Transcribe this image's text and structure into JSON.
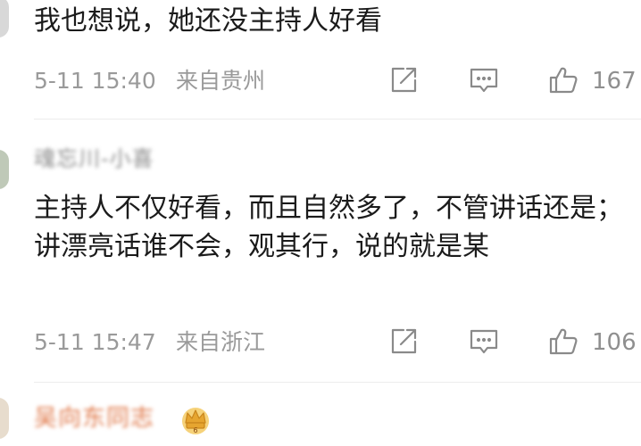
{
  "comments": [
    {
      "text": "我也想说，她还没主持人好看",
      "time": "5-11 15:40",
      "source": "来自贵州",
      "likes": "167"
    },
    {
      "username": "魂忘川-小喜",
      "text": "主持人不仅好看，而且自然多了，不管讲话还是； 讲漂亮话谁不会，观其行，说的就是某",
      "time": "5-11 15:47",
      "source": "来自浙江",
      "likes": "106"
    }
  ],
  "next_comment": {
    "username": "吴向东同志",
    "badge_icon": "crown-badge-icon"
  },
  "colors": {
    "text": "#1b1b1b",
    "meta": "#9a9a9a",
    "icon": "#8a8a8a",
    "vip_name": "#e0794a",
    "badge": "#e6a530"
  },
  "icons": [
    "repost-icon",
    "comment-icon",
    "like-icon",
    "crown-badge-icon"
  ]
}
